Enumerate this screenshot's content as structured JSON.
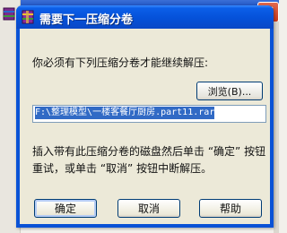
{
  "dialog": {
    "title": "需要下一压缩分卷",
    "prompt": "你必须有下列压缩分卷才能继续解压:",
    "browse_label": "浏览(B)...",
    "path_value": "F:\\整理模型\\一楼客餐厅厨房.part11.rar",
    "info_text": "插入带有此压缩分卷的磁盘然后单击 “确定” 按钮重试，或单击 “取消” 按钮中断解压。",
    "ok_label": "确定",
    "cancel_label": "取消",
    "help_label": "帮助"
  },
  "icons": {
    "title_icon": "winrar-archive-icon",
    "background_app_icon": "winrar-archive-icon",
    "background_close": "close-icon"
  },
  "colors": {
    "titlebar": "#0551d9",
    "client": "#ece9d8",
    "selection": "#316ac5"
  }
}
